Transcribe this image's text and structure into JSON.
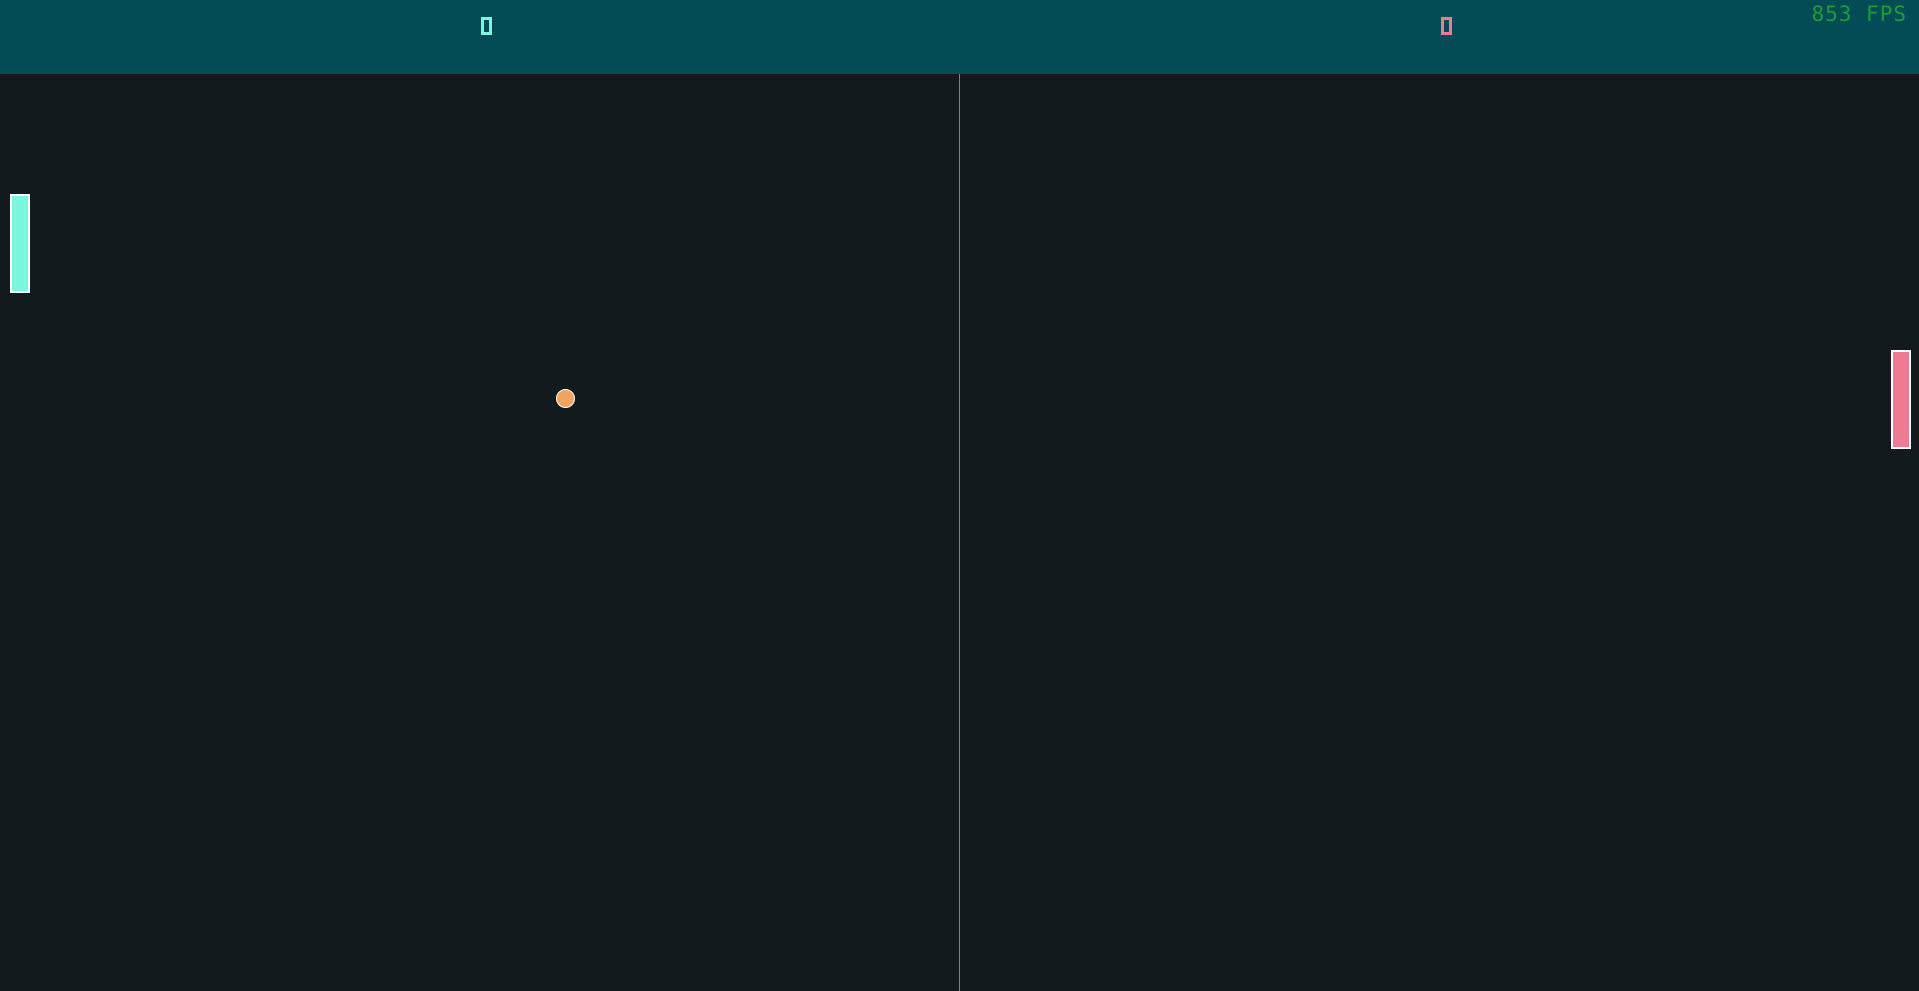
{
  "scoreboard": {
    "left_score": "0",
    "right_score": "0"
  },
  "fps_counter": "853 FPS",
  "colors": {
    "background": "#131a1d",
    "scorebar": "#034b55",
    "left_player": "#7af5e0",
    "right_player": "#f07a94",
    "ball": "#f2a35e",
    "fps_text": "#1a9e3a",
    "center_line": "#7a8185"
  }
}
